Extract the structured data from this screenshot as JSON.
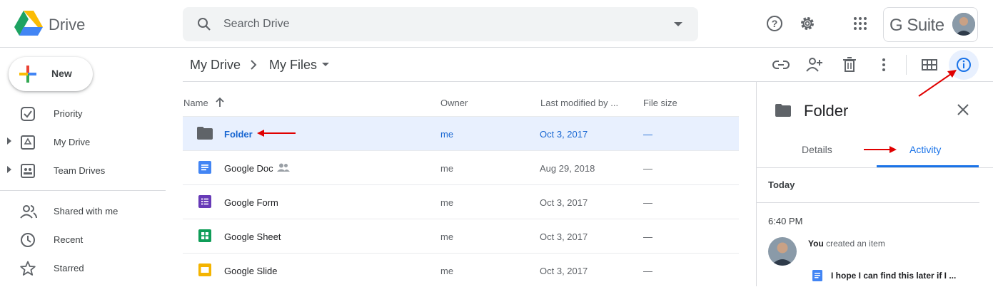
{
  "header": {
    "app_name": "Drive",
    "search_placeholder": "Search Drive",
    "brand": "G Suite"
  },
  "sidebar": {
    "new_label": "New",
    "items": [
      {
        "label": "Priority",
        "icon": "priority-icon"
      },
      {
        "label": "My Drive",
        "icon": "my-drive-icon"
      },
      {
        "label": "Team Drives",
        "icon": "team-drives-icon"
      },
      {
        "label": "Shared with me",
        "icon": "shared-icon"
      },
      {
        "label": "Recent",
        "icon": "clock-icon"
      },
      {
        "label": "Starred",
        "icon": "star-icon"
      }
    ]
  },
  "breadcrumb": {
    "root": "My Drive",
    "current": "My Files"
  },
  "table": {
    "columns": [
      "Name",
      "Owner",
      "Last modified by ...",
      "File size"
    ],
    "rows": [
      {
        "name": "Folder",
        "owner": "me",
        "modified": "Oct 3, 2017",
        "size": "—",
        "icon": "folder-icon",
        "selected": true
      },
      {
        "name": "Google Doc",
        "owner": "me",
        "modified": "Aug 29, 2018",
        "size": "—",
        "icon": "doc-icon",
        "shared": true
      },
      {
        "name": "Google Form",
        "owner": "me",
        "modified": "Oct 3, 2017",
        "size": "—",
        "icon": "form-icon"
      },
      {
        "name": "Google Sheet",
        "owner": "me",
        "modified": "Oct 3, 2017",
        "size": "—",
        "icon": "sheet-icon"
      },
      {
        "name": "Google Slide",
        "owner": "me",
        "modified": "Oct 3, 2017",
        "size": "—",
        "icon": "slide-icon"
      }
    ]
  },
  "details": {
    "title": "Folder",
    "tabs": [
      "Details",
      "Activity"
    ],
    "active_tab": "Activity",
    "today_label": "Today",
    "time": "6:40 PM",
    "actor": "You",
    "action": "created an item",
    "item": "I hope I can find this later if I ..."
  },
  "colors": {
    "accent": "#1a73e8",
    "selected_row": "#e8f0fe",
    "annotation_arrow": "#e00000"
  }
}
